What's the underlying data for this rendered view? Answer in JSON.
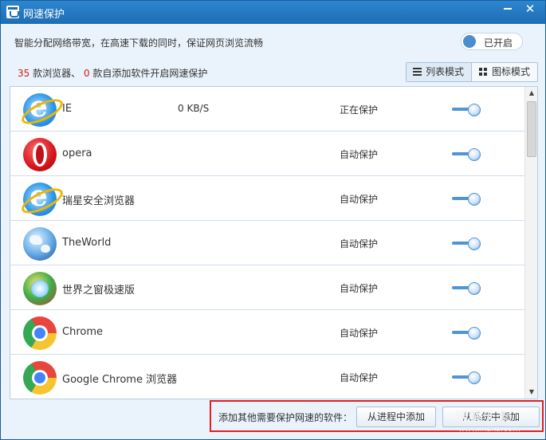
{
  "window": {
    "title": "网速保护",
    "minimize_icon": "minimize-icon",
    "close_label": "✕"
  },
  "header": {
    "description": "智能分配网络带宽，在高速下载的同时，保证网页浏览流畅",
    "main_toggle_label": "已开启",
    "browser_count": "35",
    "browser_count_text": "款浏览器、",
    "auto_add_count": "0",
    "auto_add_text": "款自添加软件开启网速保护"
  },
  "view_modes": {
    "list_label": "列表模式",
    "icon_label": "图标模式",
    "selected": "list"
  },
  "apps": [
    {
      "name": "IE",
      "speed": "0 KB/S",
      "status": "正在保护",
      "icon": "ie-icon",
      "enabled": true
    },
    {
      "name": "opera",
      "speed": "",
      "status": "自动保护",
      "icon": "opera-icon",
      "enabled": true
    },
    {
      "name": "瑞星安全浏览器",
      "speed": "",
      "status": "自动保护",
      "icon": "ie-icon",
      "enabled": true
    },
    {
      "name": "TheWorld",
      "speed": "",
      "status": "自动保护",
      "icon": "theworld-icon",
      "enabled": true
    },
    {
      "name": "世界之窗极速版",
      "speed": "",
      "status": "自动保护",
      "icon": "theworld-chrome-icon",
      "enabled": true
    },
    {
      "name": "Chrome",
      "speed": "",
      "status": "自动保护",
      "icon": "chrome-icon",
      "enabled": true
    },
    {
      "name": "Google Chrome 浏览器",
      "speed": "",
      "status": "自动保护",
      "icon": "chrome-icon",
      "enabled": true
    }
  ],
  "footer": {
    "add_label": "添加其他需要保护网速的软件：",
    "from_process_button": "从进程中添加",
    "from_file_button": "从系统中添加"
  },
  "watermark": {
    "text": "瑞星卡卡",
    "url": "www.ikaka.com"
  },
  "colors": {
    "title_bar": "#1e6db3",
    "accent": "#4f94d4",
    "highlight_border": "#e02020",
    "count_red": "#d02020"
  }
}
